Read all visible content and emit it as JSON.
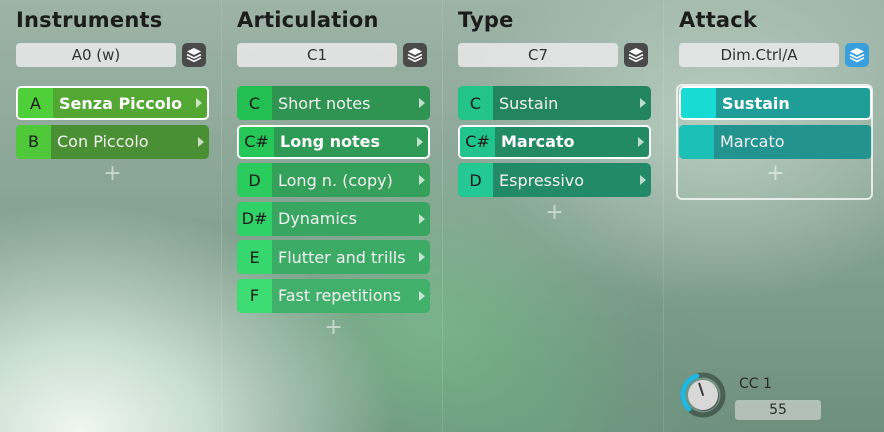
{
  "columns": [
    {
      "title": "Instruments",
      "selector": "A0 (w)",
      "layers_active": false,
      "slots": [
        {
          "key": "A",
          "label": "Senza Piccolo",
          "selected": true,
          "key_color": "#4fd03a",
          "body_color": "#52a832"
        },
        {
          "key": "B",
          "label": "Con Piccolo",
          "selected": false,
          "key_color": "#4fc83a",
          "body_color": "#4a8f34"
        }
      ]
    },
    {
      "title": "Articulation",
      "selector": "C1",
      "layers_active": false,
      "slots": [
        {
          "key": "C",
          "label": "Short notes",
          "selected": false,
          "key_color": "#22c053",
          "body_color": "#2f9452"
        },
        {
          "key": "C#",
          "label": "Long notes",
          "selected": true,
          "key_color": "#24c758",
          "body_color": "#2f9a55"
        },
        {
          "key": "D",
          "label": "Long n. (copy)",
          "selected": false,
          "key_color": "#2acc5e",
          "body_color": "#35a05a"
        },
        {
          "key": "D#",
          "label": "Dynamics",
          "selected": false,
          "key_color": "#2fd266",
          "body_color": "#38a560"
        },
        {
          "key": "E",
          "label": "Flutter and trills",
          "selected": false,
          "key_color": "#36d86d",
          "body_color": "#3cab66"
        },
        {
          "key": "F",
          "label": "Fast repetitions",
          "selected": false,
          "key_color": "#3ddd74",
          "body_color": "#40b06b"
        }
      ]
    },
    {
      "title": "Type",
      "selector": "C7",
      "layers_active": false,
      "slots": [
        {
          "key": "C",
          "label": "Sustain",
          "selected": false,
          "key_color": "#22c48a",
          "body_color": "#238462"
        },
        {
          "key": "C#",
          "label": "Marcato",
          "selected": true,
          "key_color": "#22c48e",
          "body_color": "#238a66"
        },
        {
          "key": "D",
          "label": "Espressivo",
          "selected": false,
          "key_color": "#24c892",
          "body_color": "#238a68"
        }
      ]
    },
    {
      "title": "Attack",
      "selector": "Dim.Ctrl/A",
      "layers_active": true,
      "slots": [
        {
          "key": "",
          "label": "Sustain",
          "selected": true,
          "key_color": "#18dcd4",
          "body_color": "#1f9e98"
        },
        {
          "key": "",
          "label": "Marcato",
          "selected": false,
          "key_color": "#1bc0b6",
          "body_color": "#22938e"
        }
      ]
    }
  ],
  "add_symbol": "+",
  "controller": {
    "label": "CC 1",
    "value": "55",
    "level": 55,
    "max": 127,
    "accent": "#20b8e0"
  }
}
